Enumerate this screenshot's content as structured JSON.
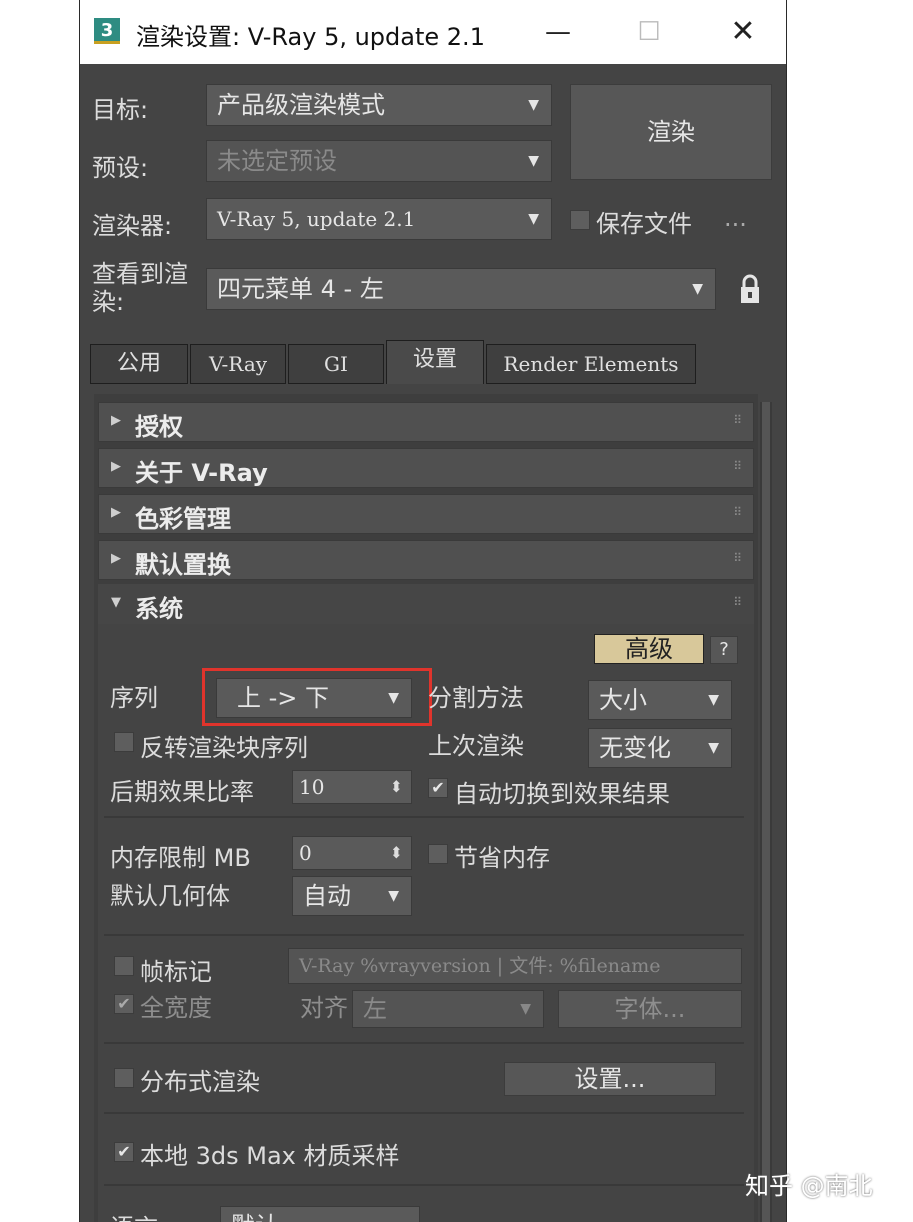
{
  "window": {
    "app_icon_text": "3",
    "title": "渲染设置: V-Ray 5, update 2.1",
    "minimize": "—",
    "maximize": "☐",
    "close": "✕"
  },
  "header": {
    "target_label": "目标:",
    "target_value": "产品级渲染模式",
    "preset_label": "预设:",
    "preset_value": "未选定预设",
    "renderer_label": "渲染器:",
    "renderer_value": "V-Ray 5, update 2.1",
    "view_label_line1": "查看到渲",
    "view_label_line2": "染:",
    "view_value": "四元菜单 4 - 左",
    "render_button": "渲染",
    "save_file_label": "保存文件",
    "save_file_more": "...",
    "lock_icon": "lock-icon"
  },
  "tabs": [
    {
      "label": "公用"
    },
    {
      "label": "V-Ray"
    },
    {
      "label": "GI"
    },
    {
      "label": "设置"
    },
    {
      "label": "Render Elements"
    }
  ],
  "rollouts": [
    {
      "title": "授权"
    },
    {
      "title": "关于 V-Ray"
    },
    {
      "title": "色彩管理"
    },
    {
      "title": "默认置换"
    },
    {
      "title": "系统"
    }
  ],
  "system": {
    "advanced_button": "高级",
    "help_button": "?",
    "sequence_label": "序列",
    "sequence_value": "上 -> 下",
    "split_method_label": "分割方法",
    "split_method_value": "大小",
    "reverse_sequence_label": "反转渲染块序列",
    "last_render_label": "上次渲染",
    "last_render_value": "无变化",
    "post_effects_rate_label": "后期效果比率",
    "post_effects_rate_value": "10",
    "auto_switch_label": "自动切换到效果结果",
    "auto_switch_checked": true,
    "memory_limit_label": "内存限制 MB",
    "memory_limit_value": "0",
    "conserve_memory_label": "节省内存",
    "default_geometry_label": "默认几何体",
    "default_geometry_value": "自动",
    "frame_stamp_label": "帧标记",
    "frame_stamp_text": "V-Ray %vrayversion | 文件: %filename",
    "full_width_label": "全宽度",
    "full_width_checked": true,
    "align_label": "对齐",
    "align_value": "左",
    "font_button": "字体...",
    "distributed_label": "分布式渲染",
    "distributed_settings_button": "设置...",
    "local_material_label": "本地 3ds Max 材质采样",
    "local_material_checked": true,
    "language_label": "语言",
    "language_value": "默认"
  },
  "watermark": "知乎 @南北",
  "colors": {
    "panel_bg": "#444444",
    "highlight_box": "#e0342c",
    "advanced_button_bg": "#d8c89a"
  }
}
